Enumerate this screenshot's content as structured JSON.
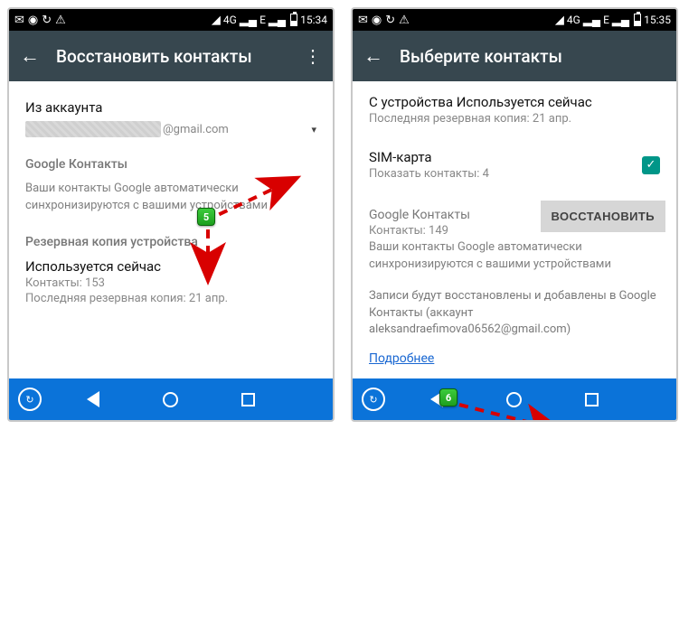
{
  "left": {
    "status": {
      "time": "15:34",
      "net": "4G"
    },
    "appbar": {
      "title": "Восстановить контакты"
    },
    "account": {
      "label": "Из аккаунта",
      "suffix": "@gmail.com"
    },
    "google": {
      "header": "Google Контакты",
      "desc": "Ваши контакты Google автоматически синхронизируются с вашими устройствами"
    },
    "backup": {
      "header": "Резервная копия устройства",
      "device": "Используется сейчас",
      "contacts": "Контакты: 153",
      "last": "Последняя резервная копия: 21 апр."
    },
    "badge": "5"
  },
  "right": {
    "status": {
      "time": "15:35",
      "net": "4G"
    },
    "appbar": {
      "title": "Выберите контакты"
    },
    "device": {
      "title": "С устройства Используется сейчас",
      "last": "Последняя резервная копия: 21 апр."
    },
    "sim": {
      "title": "SIM-карта",
      "sub": "Показать контакты: 4"
    },
    "google": {
      "header": "Google Контакты",
      "count": "Контакты: 149",
      "desc": "Ваши контакты Google автоматически синхронизируются с вашими устройствами"
    },
    "restore_note": "Записи будут восстановлены и добавлены в Google Контакты (аккаунт aleksandraefimova06562@gmail.com)",
    "more": "Подробнее",
    "button": "ВОССТАНОВИТЬ",
    "badge": "6"
  }
}
